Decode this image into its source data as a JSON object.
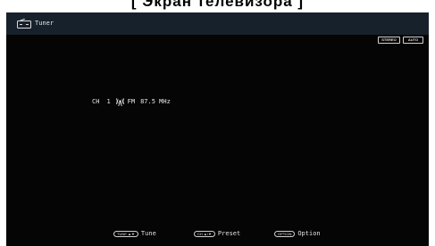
{
  "caption": "[ Экран телевизора ]",
  "header": {
    "title": "Tuner",
    "icon": "tuner-icon"
  },
  "badges": {
    "stereo": "STEREO",
    "auto": "AUTO"
  },
  "station": {
    "channel_label": "CH",
    "channel_number": "1",
    "band": "FM",
    "frequency": "87.5 MHz",
    "icon": "antenna-icon"
  },
  "footer": {
    "tune": {
      "key": "TUNE ▲▼",
      "label": "Tune"
    },
    "preset": {
      "key": "CH ▲/▼",
      "label": "Preset"
    },
    "option": {
      "key": "OPTION",
      "label": "Option"
    }
  }
}
